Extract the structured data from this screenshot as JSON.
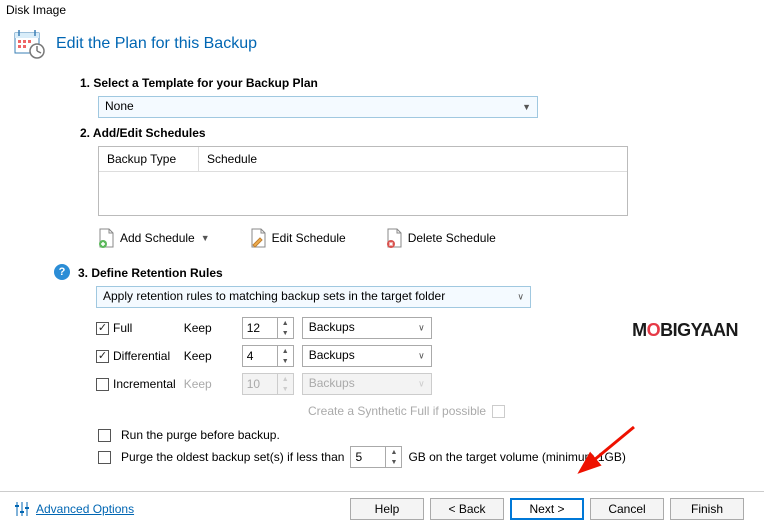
{
  "window": {
    "title": "Disk Image"
  },
  "header": {
    "title": "Edit the Plan for this Backup"
  },
  "section1": {
    "heading": "1. Select a Template for your Backup Plan",
    "template_value": "None"
  },
  "section2": {
    "heading": "2. Add/Edit Schedules",
    "col1": "Backup Type",
    "col2": "Schedule",
    "add_label": "Add Schedule",
    "edit_label": "Edit Schedule",
    "delete_label": "Delete Schedule"
  },
  "section3": {
    "heading": "3. Define Retention Rules",
    "rule_select": "Apply retention rules to matching backup sets in the target folder",
    "rows": [
      {
        "label": "Full",
        "checked": true,
        "keep": "Keep",
        "value": "12",
        "unit": "Backups",
        "enabled": true
      },
      {
        "label": "Differential",
        "checked": true,
        "keep": "Keep",
        "value": "4",
        "unit": "Backups",
        "enabled": true
      },
      {
        "label": "Incremental",
        "checked": false,
        "keep": "Keep",
        "value": "10",
        "unit": "Backups",
        "enabled": false
      }
    ],
    "synth_label": "Create a Synthetic Full if possible"
  },
  "purge": {
    "before": "Run the purge before backup.",
    "oldest_prefix": "Purge the oldest backup set(s) if less than",
    "oldest_value": "5",
    "oldest_suffix": "GB on the target volume (minimum 1GB)"
  },
  "footer": {
    "advanced": "Advanced Options",
    "help": "Help",
    "back": "< Back",
    "next": "Next >",
    "cancel": "Cancel",
    "finish": "Finish"
  },
  "watermark": {
    "pre": "M",
    "o": "O",
    "post": "BIGYAAN"
  }
}
